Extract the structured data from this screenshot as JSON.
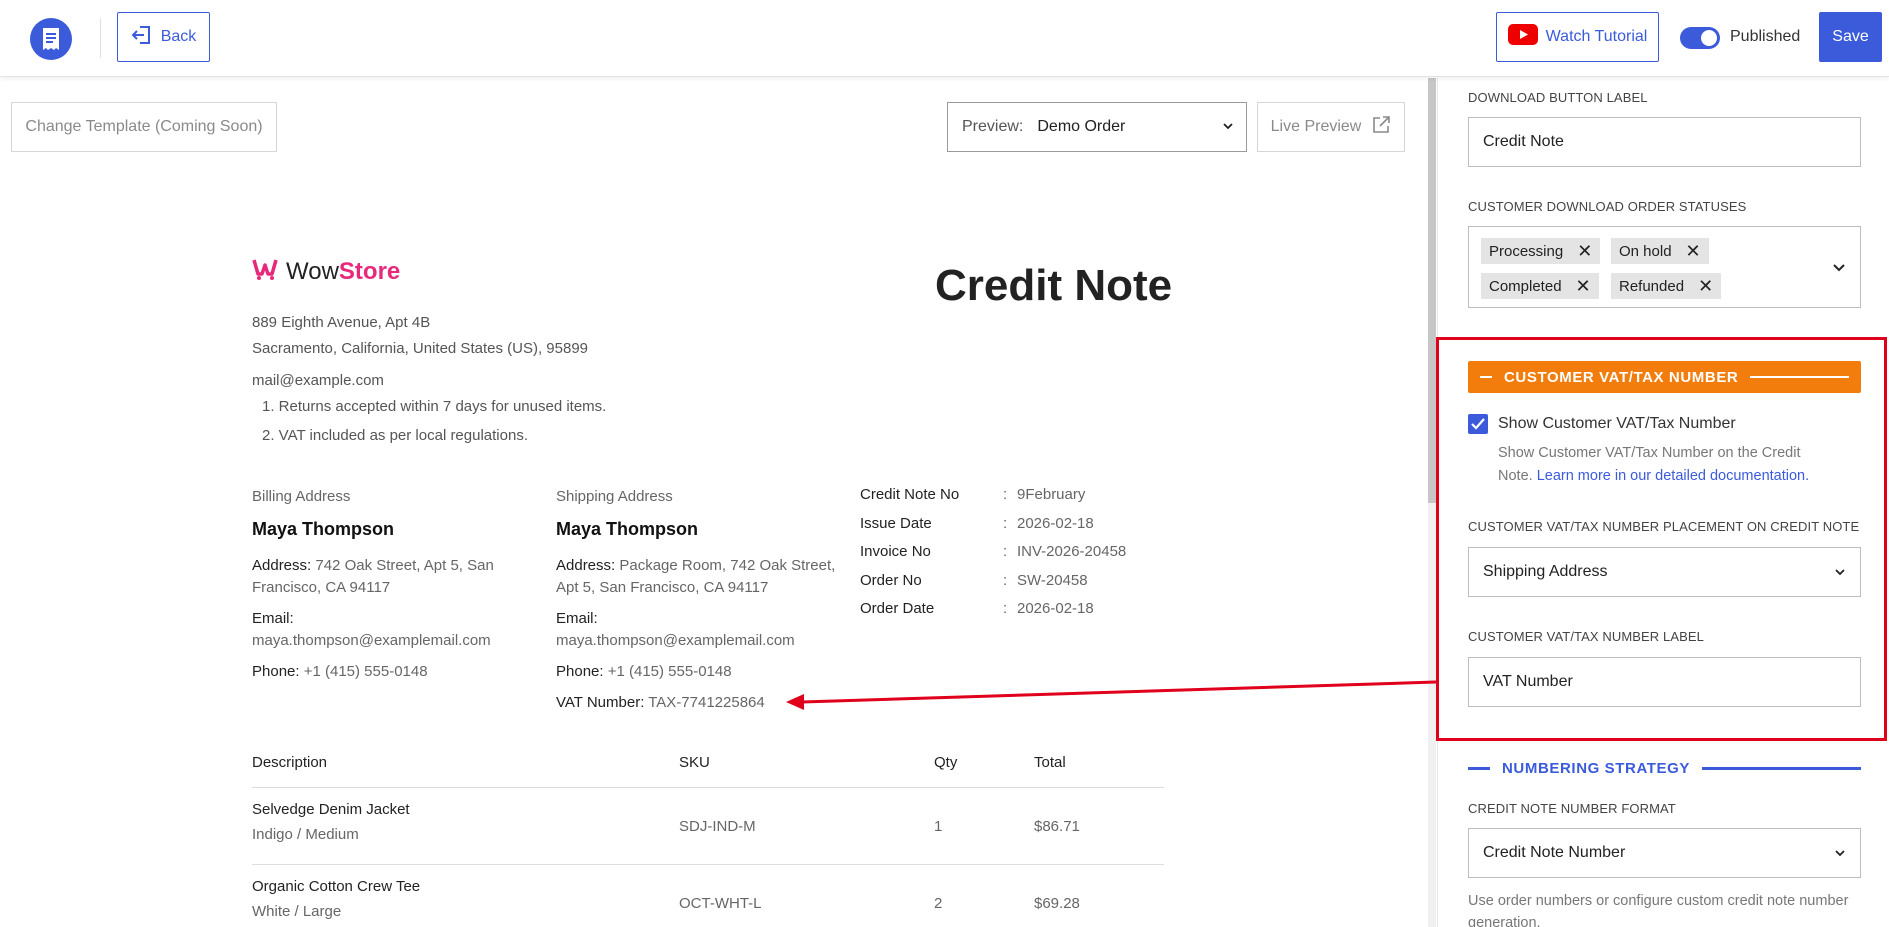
{
  "topbar": {
    "back_label": "Back",
    "watch_label": "Watch Tutorial",
    "published_label": "Published",
    "published_on": true,
    "save_label": "Save"
  },
  "preview_toolbar": {
    "change_template_label": "Change Template (Coming Soon)",
    "preview_prefix": "Preview:",
    "preview_value": "Demo Order",
    "live_preview_label": "Live Preview"
  },
  "document": {
    "brand_wow": "Wow",
    "brand_store": "Store",
    "title": "Credit Note",
    "address_line1": "889 Eighth Avenue, Apt 4B",
    "address_line2": "Sacramento, California, United States (US), 95899",
    "store_email": "mail@example.com",
    "notes": [
      "1. Returns accepted within 7 days for unused items.",
      "2. VAT included as per local regulations."
    ],
    "billing": {
      "heading": "Billing Address",
      "name": "Maya Thompson",
      "address_label": "Address:",
      "address_value": " 742 Oak Street, Apt 5, San",
      "address_value2": "Francisco, CA 94117",
      "email_label": "Email:",
      "email_value": "maya.thompson@examplemail.com",
      "phone_label": "Phone:",
      "phone_value": " +1 (415) 555-0148"
    },
    "shipping": {
      "heading": "Shipping Address",
      "name": "Maya Thompson",
      "address_label": "Address:",
      "address_value": " Package Room, 742 Oak Street,",
      "address_value2": "Apt 5, San Francisco, CA 94117",
      "email_label": "Email:",
      "email_value": "maya.thompson@examplemail.com",
      "phone_label": "Phone:",
      "phone_value": " +1 (415) 555-0148",
      "vat_label": "VAT Number:",
      "vat_value": " TAX-7741225864"
    },
    "meta": [
      {
        "label": "Credit Note No",
        "sep": ":",
        "value": "9February"
      },
      {
        "label": "Issue Date",
        "sep": ":",
        "value": "2026-02-18"
      },
      {
        "label": "Invoice No",
        "sep": ":",
        "value": "INV-2026-20458"
      },
      {
        "label": "Order No",
        "sep": ":",
        "value": "SW-20458"
      },
      {
        "label": "Order Date",
        "sep": ":",
        "value": "2026-02-18"
      }
    ],
    "table": {
      "headers": {
        "description": "Description",
        "sku": "SKU",
        "qty": "Qty",
        "total": "Total"
      },
      "rows": [
        {
          "name": "Selvedge Denim Jacket",
          "variant": "Indigo / Medium",
          "sku": "SDJ-IND-M",
          "qty": "1",
          "total": "$86.71"
        },
        {
          "name": "Organic Cotton Crew Tee",
          "variant": "White / Large",
          "sku": "OCT-WHT-L",
          "qty": "2",
          "total": "$69.28"
        }
      ]
    }
  },
  "panel": {
    "download_label_heading": "DOWNLOAD BUTTON LABEL",
    "download_label_value": "Credit Note",
    "statuses_heading": "CUSTOMER DOWNLOAD ORDER STATUSES",
    "statuses": [
      "Processing",
      "On hold",
      "Completed",
      "Refunded"
    ],
    "vat_section_title": "CUSTOMER VAT/TAX NUMBER",
    "show_vat_label": "Show Customer VAT/Tax Number",
    "show_vat_checked": true,
    "help_text": "Show Customer VAT/Tax Number on the Credit Note. ",
    "help_link": "Learn more in our detailed documentation.",
    "placement_heading": "CUSTOMER VAT/TAX NUMBER PLACEMENT ON CREDIT NOTE",
    "placement_value": "Shipping Address",
    "vat_label_heading": "CUSTOMER VAT/TAX NUMBER LABEL",
    "vat_label_value": "VAT Number",
    "numbering_title": "NUMBERING STRATEGY",
    "number_format_heading": "CREDIT NOTE NUMBER FORMAT",
    "number_format_value": "Credit Note Number",
    "number_help": "Use order numbers or configure custom credit note number generation."
  },
  "colors": {
    "accent": "#3b5bdb",
    "orange": "#f27d0c",
    "highlight": "#e0001b",
    "brand_pink": "#e6297a"
  }
}
